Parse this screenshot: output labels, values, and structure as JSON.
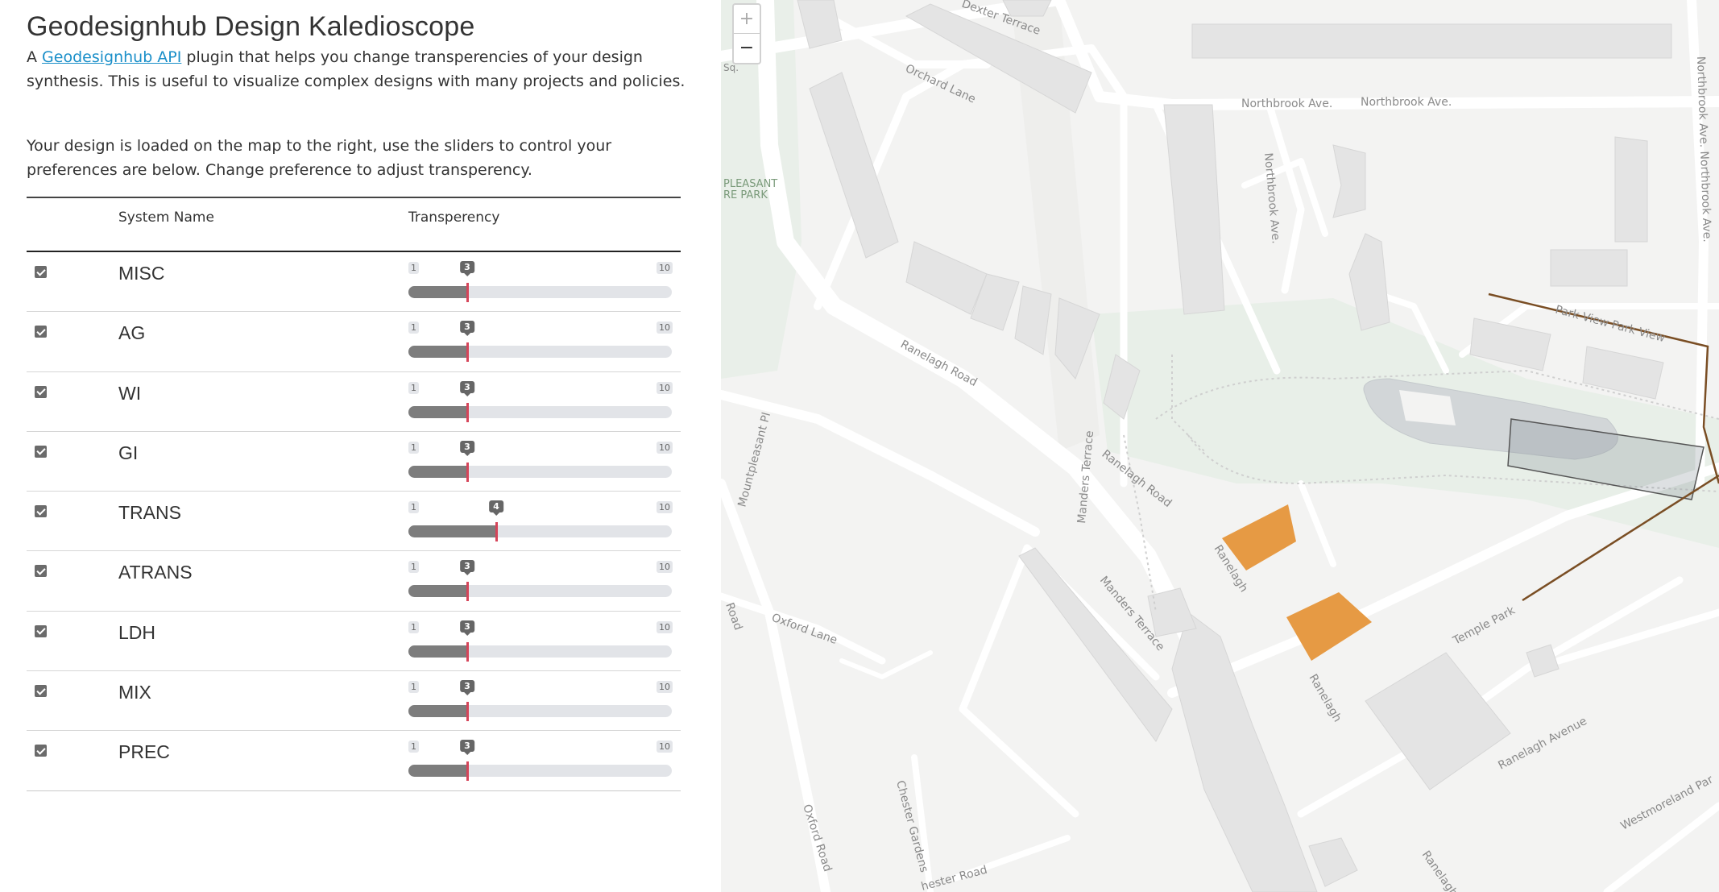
{
  "header": {
    "title": "Geodesignhub Design Kaledioscope",
    "intro_prefix": "A ",
    "intro_link": "Geodesignhub API",
    "intro_suffix": " plugin that helps you change transperencies of your design synthesis. This is useful to visualize complex designs with many projects and policies.",
    "instructions": "Your design is loaded on the map to the right, use the sliders to control your preferences are below. Change preference to adjust transperency."
  },
  "table": {
    "col_name": "System Name",
    "col_transparency": "Transperency",
    "slider_min": 1,
    "slider_max": 10,
    "rows": [
      {
        "name": "MISC",
        "checked": true,
        "value": 3
      },
      {
        "name": "AG",
        "checked": true,
        "value": 3
      },
      {
        "name": "WI",
        "checked": true,
        "value": 3
      },
      {
        "name": "GI",
        "checked": true,
        "value": 3
      },
      {
        "name": "TRANS",
        "checked": true,
        "value": 4
      },
      {
        "name": "ATRANS",
        "checked": true,
        "value": 3
      },
      {
        "name": "LDH",
        "checked": true,
        "value": 3
      },
      {
        "name": "MIX",
        "checked": true,
        "value": 3
      },
      {
        "name": "PREC",
        "checked": true,
        "value": 3
      }
    ]
  },
  "map": {
    "zoom_in": "+",
    "zoom_out": "−",
    "labels": [
      "Dexter Terrace",
      "Orchard Lane",
      "Northbrook Ave.",
      "Northbrook Ave.",
      "Northbrook Ave.",
      "Northbrook Ave. Northbrook Ave.",
      "PLEASANT",
      "RE PARK",
      "Park View Park View",
      "Ranelagh Road",
      "Ranelagh Road",
      "Ranelagh",
      "Ranelagh",
      "Ranelagh",
      "Manders Terrace",
      "Manders Terrace",
      "Mountpleasant Pl",
      "Oxford Lane",
      "Oxford Road",
      "Road",
      "Chester Gardens",
      "hester Road",
      "Temple Park",
      "Ranelagh Avenue",
      "Westmoreland Par",
      "Sq."
    ],
    "colors": {
      "background": "#f3f3f2",
      "road": "#ffffff",
      "building": "#e4e4e4",
      "park": "#e8efe8",
      "design_fill": "#e69a44",
      "design_line": "#7a4e24",
      "water": "#d2d6d8"
    }
  }
}
